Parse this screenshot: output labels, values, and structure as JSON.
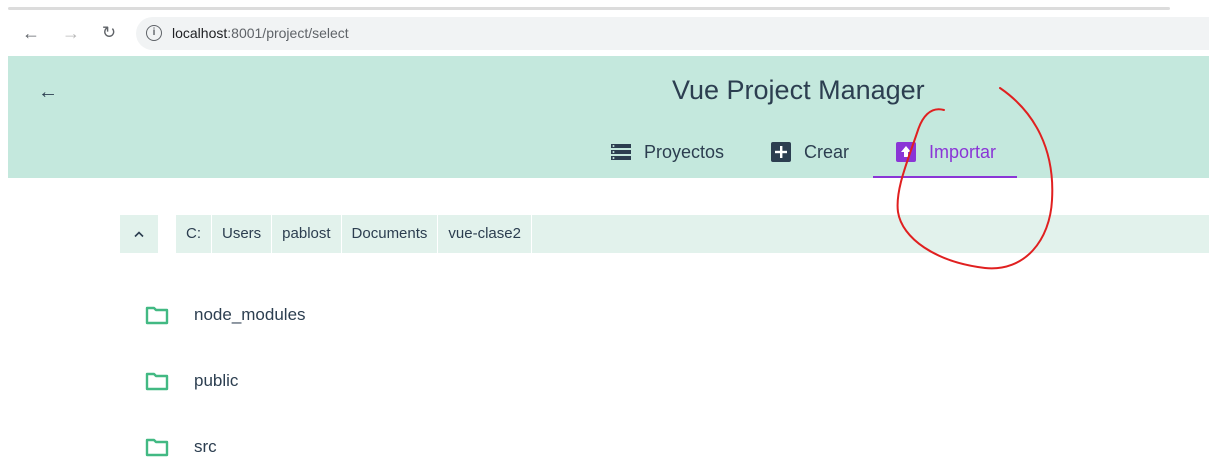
{
  "browser": {
    "url_host": "localhost",
    "url_path": ":8001/project/select",
    "icons": {
      "back": "arrow-left-icon",
      "forward": "arrow-right-icon",
      "reload": "reload-icon",
      "info": "info-icon"
    }
  },
  "header": {
    "title": "Vue Project Manager",
    "tabs": [
      {
        "label": "Proyectos",
        "icon": "list-icon",
        "active": false
      },
      {
        "label": "Crear",
        "icon": "plus-box-icon",
        "active": false
      },
      {
        "label": "Importar",
        "icon": "import-icon",
        "active": true
      }
    ]
  },
  "breadcrumb": {
    "parts": [
      "C:",
      "Users",
      "pablost",
      "Documents",
      "vue-clase2"
    ]
  },
  "folders": [
    {
      "name": "node_modules"
    },
    {
      "name": "public"
    },
    {
      "name": "src"
    }
  ],
  "colors": {
    "header_bg": "#c4e8dd",
    "crumb_bg": "#e2f2ec",
    "accent": "#8a35d6",
    "folder": "#42b983",
    "annotation": "#e02020"
  }
}
